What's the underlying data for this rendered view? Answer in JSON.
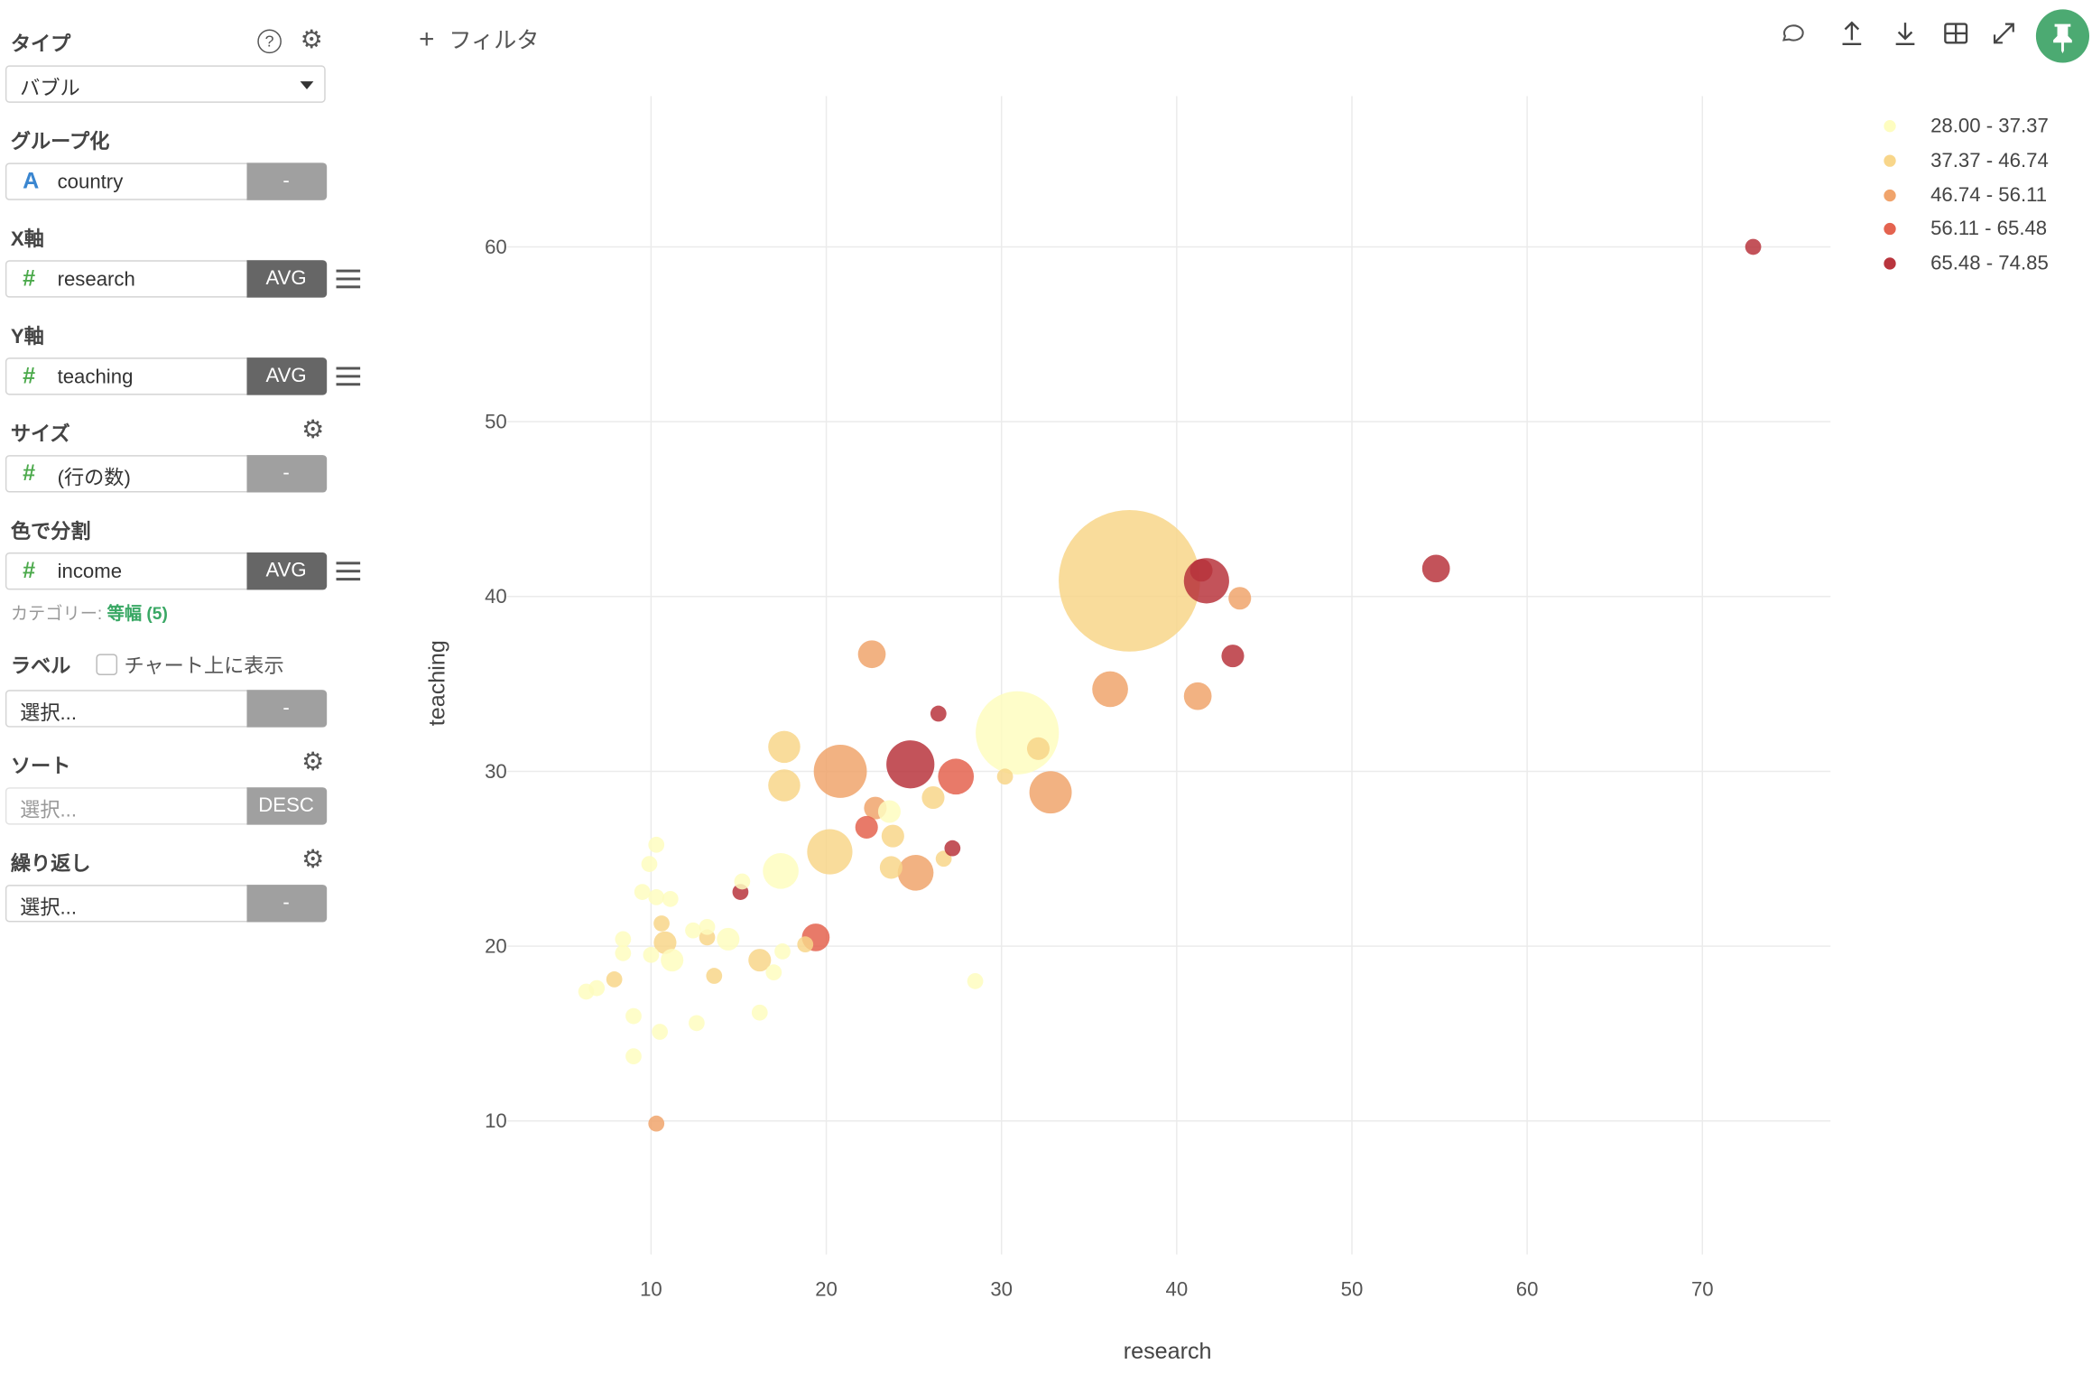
{
  "sidebar": {
    "type": {
      "label": "タイプ",
      "value": "バブル"
    },
    "group": {
      "label": "グループ化",
      "field": "country",
      "field_type_icon": "A",
      "button": "-"
    },
    "x_axis": {
      "label": "X軸",
      "field": "research",
      "field_type_icon": "#",
      "button": "AVG"
    },
    "y_axis": {
      "label": "Y軸",
      "field": "teaching",
      "field_type_icon": "#",
      "button": "AVG"
    },
    "size": {
      "label": "サイズ",
      "field": "(行の数)",
      "field_type_icon": "#",
      "button": "-"
    },
    "color": {
      "label": "色で分割",
      "field": "income",
      "field_type_icon": "#",
      "button": "AVG",
      "category_prefix": "カテゴリー: ",
      "category_value": "等幅 (5)"
    },
    "label": {
      "label": "ラベル",
      "checkbox_label": "チャート上に表示",
      "checked": false,
      "placeholder": "選択...",
      "button": "-"
    },
    "sort": {
      "label": "ソート",
      "placeholder": "選択...",
      "button": "DESC"
    },
    "repeat": {
      "label": "繰り返し",
      "placeholder": "選択...",
      "button": "-"
    }
  },
  "toolbar": {
    "filter_label": "フィルタ",
    "icons": [
      "comment-icon",
      "upload-icon",
      "download-icon",
      "table-icon",
      "expand-icon",
      "pin-icon"
    ],
    "accent": "#4caa72"
  },
  "chart_data": {
    "type": "scatter",
    "subtype": "bubble",
    "xlabel": "research",
    "ylabel": "teaching",
    "xlim": [
      3,
      77
    ],
    "ylim": [
      2,
      68
    ],
    "xticks": [
      10,
      20,
      30,
      40,
      50,
      60,
      70
    ],
    "yticks": [
      10,
      20,
      30,
      40,
      50,
      60
    ],
    "grid": true,
    "legend_position": "top-right",
    "legend": [
      {
        "label": "28.00 - 37.37",
        "color": "#fefdc0"
      },
      {
        "label": "37.37 - 46.74",
        "color": "#f8d68a"
      },
      {
        "label": "46.74 - 56.11",
        "color": "#f0a46c"
      },
      {
        "label": "56.11 - 65.48",
        "color": "#e4634f"
      },
      {
        "label": "65.48 - 74.85",
        "color": "#b9353d"
      }
    ],
    "points": [
      {
        "x": 37.3,
        "y": 40.9,
        "size": 78,
        "c": 1
      },
      {
        "x": 41.7,
        "y": 40.9,
        "size": 8,
        "c": 4
      },
      {
        "x": 41.4,
        "y": 41.5,
        "size": 2,
        "c": 4
      },
      {
        "x": 43.6,
        "y": 39.9,
        "size": 2,
        "c": 2
      },
      {
        "x": 54.8,
        "y": 41.6,
        "size": 3,
        "c": 4
      },
      {
        "x": 72.9,
        "y": 60,
        "size": 1,
        "c": 4
      },
      {
        "x": 43.2,
        "y": 36.6,
        "size": 2,
        "c": 4
      },
      {
        "x": 41.2,
        "y": 34.3,
        "size": 3,
        "c": 2
      },
      {
        "x": 36.2,
        "y": 34.7,
        "size": 5,
        "c": 2
      },
      {
        "x": 22.6,
        "y": 36.7,
        "size": 3,
        "c": 2
      },
      {
        "x": 26.4,
        "y": 33.3,
        "size": 1,
        "c": 4
      },
      {
        "x": 30.9,
        "y": 32.2,
        "size": 27,
        "c": 0
      },
      {
        "x": 32.1,
        "y": 31.3,
        "size": 2,
        "c": 1
      },
      {
        "x": 32.8,
        "y": 28.8,
        "size": 7,
        "c": 2
      },
      {
        "x": 30.2,
        "y": 29.7,
        "size": 1,
        "c": 1
      },
      {
        "x": 27.4,
        "y": 29.7,
        "size": 5,
        "c": 3
      },
      {
        "x": 24.8,
        "y": 30.4,
        "size": 9,
        "c": 4
      },
      {
        "x": 20.8,
        "y": 30.0,
        "size": 11,
        "c": 2
      },
      {
        "x": 17.6,
        "y": 31.4,
        "size": 4,
        "c": 1
      },
      {
        "x": 17.6,
        "y": 29.2,
        "size": 4,
        "c": 1
      },
      {
        "x": 26.1,
        "y": 28.5,
        "size": 2,
        "c": 1
      },
      {
        "x": 22.8,
        "y": 27.9,
        "size": 2,
        "c": 2
      },
      {
        "x": 23.6,
        "y": 27.7,
        "size": 2,
        "c": 0
      },
      {
        "x": 22.3,
        "y": 26.8,
        "size": 2,
        "c": 3
      },
      {
        "x": 23.8,
        "y": 26.3,
        "size": 2,
        "c": 1
      },
      {
        "x": 20.2,
        "y": 25.4,
        "size": 8,
        "c": 1
      },
      {
        "x": 17.4,
        "y": 24.3,
        "size": 5,
        "c": 0
      },
      {
        "x": 25.1,
        "y": 24.2,
        "size": 5,
        "c": 2
      },
      {
        "x": 23.7,
        "y": 24.5,
        "size": 2,
        "c": 1
      },
      {
        "x": 26.7,
        "y": 25.0,
        "size": 1,
        "c": 1
      },
      {
        "x": 27.2,
        "y": 25.6,
        "size": 1,
        "c": 4
      },
      {
        "x": 15.1,
        "y": 23.1,
        "size": 1,
        "c": 4
      },
      {
        "x": 15.2,
        "y": 23.7,
        "size": 1,
        "c": 0
      },
      {
        "x": 19.4,
        "y": 20.5,
        "size": 3,
        "c": 3
      },
      {
        "x": 18.8,
        "y": 20.1,
        "size": 1,
        "c": 1
      },
      {
        "x": 16.2,
        "y": 19.2,
        "size": 2,
        "c": 1
      },
      {
        "x": 17.0,
        "y": 18.5,
        "size": 1,
        "c": 0
      },
      {
        "x": 17.5,
        "y": 19.7,
        "size": 1,
        "c": 0
      },
      {
        "x": 28.5,
        "y": 18.0,
        "size": 1,
        "c": 0
      },
      {
        "x": 16.2,
        "y": 16.2,
        "size": 1,
        "c": 0
      },
      {
        "x": 13.6,
        "y": 18.3,
        "size": 1,
        "c": 1
      },
      {
        "x": 14.4,
        "y": 20.4,
        "size": 2,
        "c": 0
      },
      {
        "x": 13.2,
        "y": 20.5,
        "size": 1,
        "c": 1
      },
      {
        "x": 13.2,
        "y": 21.1,
        "size": 1,
        "c": 0
      },
      {
        "x": 12.4,
        "y": 20.9,
        "size": 1,
        "c": 0
      },
      {
        "x": 12.6,
        "y": 15.6,
        "size": 1,
        "c": 0
      },
      {
        "x": 10.3,
        "y": 25.8,
        "size": 1,
        "c": 0
      },
      {
        "x": 9.9,
        "y": 24.7,
        "size": 1,
        "c": 0
      },
      {
        "x": 9.5,
        "y": 23.1,
        "size": 1,
        "c": 0
      },
      {
        "x": 10.3,
        "y": 22.8,
        "size": 1,
        "c": 0
      },
      {
        "x": 11.1,
        "y": 22.7,
        "size": 1,
        "c": 0
      },
      {
        "x": 10.6,
        "y": 21.3,
        "size": 1,
        "c": 1
      },
      {
        "x": 10.8,
        "y": 20.2,
        "size": 2,
        "c": 1
      },
      {
        "x": 11.2,
        "y": 19.2,
        "size": 2,
        "c": 0
      },
      {
        "x": 10.0,
        "y": 19.5,
        "size": 1,
        "c": 0
      },
      {
        "x": 8.4,
        "y": 20.4,
        "size": 1,
        "c": 0
      },
      {
        "x": 8.4,
        "y": 19.6,
        "size": 1,
        "c": 0
      },
      {
        "x": 7.9,
        "y": 18.1,
        "size": 1,
        "c": 1
      },
      {
        "x": 6.9,
        "y": 17.6,
        "size": 1,
        "c": 0
      },
      {
        "x": 6.3,
        "y": 17.4,
        "size": 1,
        "c": 0
      },
      {
        "x": 9.0,
        "y": 16.0,
        "size": 1,
        "c": 0
      },
      {
        "x": 10.5,
        "y": 15.1,
        "size": 1,
        "c": 0
      },
      {
        "x": 9.0,
        "y": 13.7,
        "size": 1,
        "c": 0
      },
      {
        "x": 10.3,
        "y": 9.85,
        "size": 1,
        "c": 2
      }
    ]
  }
}
